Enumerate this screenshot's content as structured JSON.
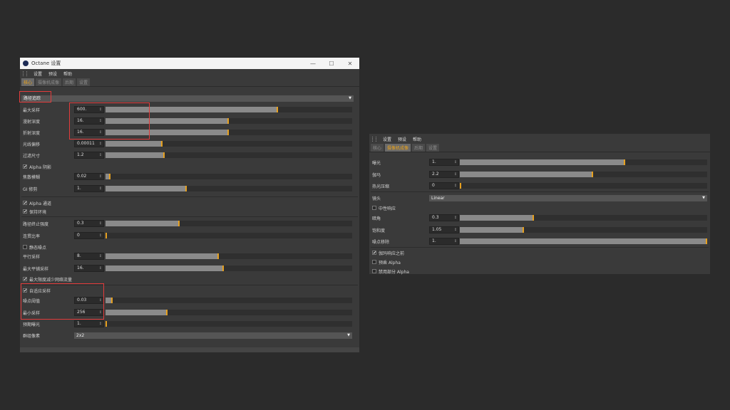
{
  "window1": {
    "title": "Octane 设置",
    "menu": [
      "设置",
      "预设",
      "帮助"
    ],
    "tabs": [
      "核心",
      "摄像机成像",
      "后期",
      "设置"
    ],
    "kernel": "路径追踪",
    "rows": {
      "max_samples": {
        "label": "最大采样",
        "value": "600.",
        "fill": 0.7
      },
      "diffuse_depth": {
        "label": "漫射深度",
        "value": "16.",
        "fill": 0.5
      },
      "specular_depth": {
        "label": "折射深度",
        "value": "16.",
        "fill": 0.5
      },
      "ray_epsilon": {
        "label": "光线偏移",
        "value": "0.00011",
        "fill": 0.23
      },
      "filter_size": {
        "label": "过滤尺寸",
        "value": "1.2",
        "fill": 0.24
      },
      "alpha_shadows": {
        "label": "Alpha 阴影",
        "checked": true
      },
      "caustic_blur": {
        "label": "焦散模糊",
        "value": "0.02",
        "fill": 0.02
      },
      "gi_clamp": {
        "label": "GI 修剪",
        "value": "1.",
        "fill": 0.33
      },
      "alpha_channel": {
        "label": "Alpha 通道",
        "checked": true
      },
      "keep_env": {
        "label": "保持环境",
        "checked": true
      },
      "path_term": {
        "label": "路径终止强度",
        "value": "0.3",
        "fill": 0.3
      },
      "coherent_ratio": {
        "label": "连贯比率",
        "value": "0",
        "fill": 0.0
      },
      "static_noise": {
        "label": "静态噪点",
        "checked": false
      },
      "parallel_samples": {
        "label": "平行采样",
        "value": "8.",
        "fill": 0.46
      },
      "max_tile_samples": {
        "label": "最大平铺采样",
        "value": "16.",
        "fill": 0.48
      },
      "minimize_net": {
        "label": "最大限度减少网络流量",
        "checked": true
      },
      "adaptive": {
        "label": "自适应采样",
        "checked": true
      },
      "noise_threshold": {
        "label": "噪点阈值",
        "value": "0.03",
        "fill": 0.03
      },
      "min_samples": {
        "label": "最小采样",
        "value": "256",
        "fill": 0.25
      },
      "exposure": {
        "label": "预期曝光",
        "value": "1.",
        "fill": 0.0
      },
      "group_pixels": {
        "label": "群组像素",
        "value": "2x2"
      }
    }
  },
  "window2": {
    "menu": [
      "设置",
      "预设",
      "帮助"
    ],
    "tabs": [
      "核心",
      "摄像机成像",
      "后期",
      "设置"
    ],
    "rows": {
      "exposure": {
        "label": "曝光",
        "value": "1.",
        "fill": 0.67
      },
      "gamma": {
        "label": "伽马",
        "value": "2.2",
        "fill": 0.54
      },
      "hotpixel": {
        "label": "热光压缩",
        "value": "0",
        "fill": 0.0
      },
      "lens": {
        "label": "镜头",
        "value": "Linear"
      },
      "neutral": {
        "label": "中性响应",
        "checked": false
      },
      "vignetting": {
        "label": "暗角",
        "value": "0.3",
        "fill": 0.3
      },
      "saturation": {
        "label": "饱和度",
        "value": "1.05",
        "fill": 0.26
      },
      "hot_removal": {
        "label": "噪点移除",
        "value": "1.",
        "fill": 1.0
      },
      "premultiplied": {
        "label": "伽玛响应之前",
        "checked": true
      },
      "premult_alpha": {
        "label": "预乘 Alpha",
        "checked": false
      },
      "disable_partial": {
        "label": "禁用部分 Alpha",
        "checked": false
      }
    }
  },
  "colors": {
    "accent": "#e6a01f",
    "highlight": "#e23b3b",
    "bg": "#2b2b2b",
    "panel": "#3a3a3a"
  }
}
